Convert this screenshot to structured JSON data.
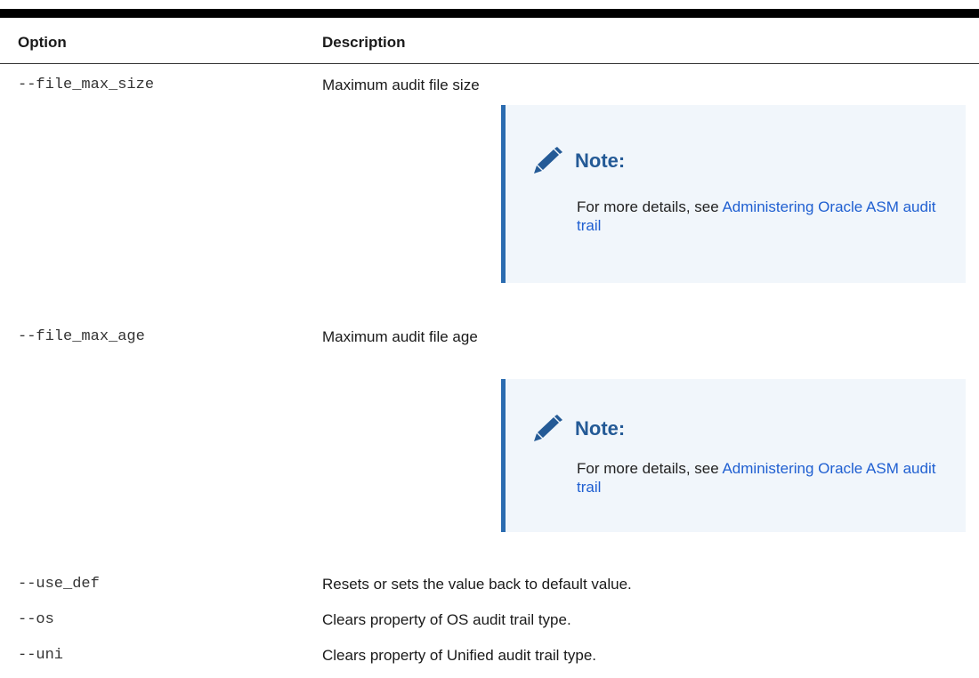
{
  "table": {
    "headers": {
      "option": "Option",
      "description": "Description"
    },
    "rows": [
      {
        "option": "--file_max_size",
        "description": "Maximum audit file size",
        "note": {
          "title": "Note:",
          "text": "For more details, see ",
          "link": "Administering Oracle ASM audit trail"
        }
      },
      {
        "option": "--file_max_age",
        "description": "Maximum audit file age",
        "note": {
          "title": "Note:",
          "text": "For more details, see ",
          "link": "Administering Oracle ASM audit trail"
        }
      },
      {
        "option": "--use_def",
        "description": "Resets or sets the value back to default value."
      },
      {
        "option": "--os",
        "description": "Clears property of OS audit trail type."
      },
      {
        "option": "--uni",
        "description": "Clears property of Unified audit trail type."
      }
    ]
  },
  "icons": {
    "note": "pencil-icon"
  },
  "colors": {
    "note_title": "#245a96",
    "note_border": "#2b6cb0",
    "note_background": "#f1f6fb",
    "link": "#1f5fd1"
  }
}
